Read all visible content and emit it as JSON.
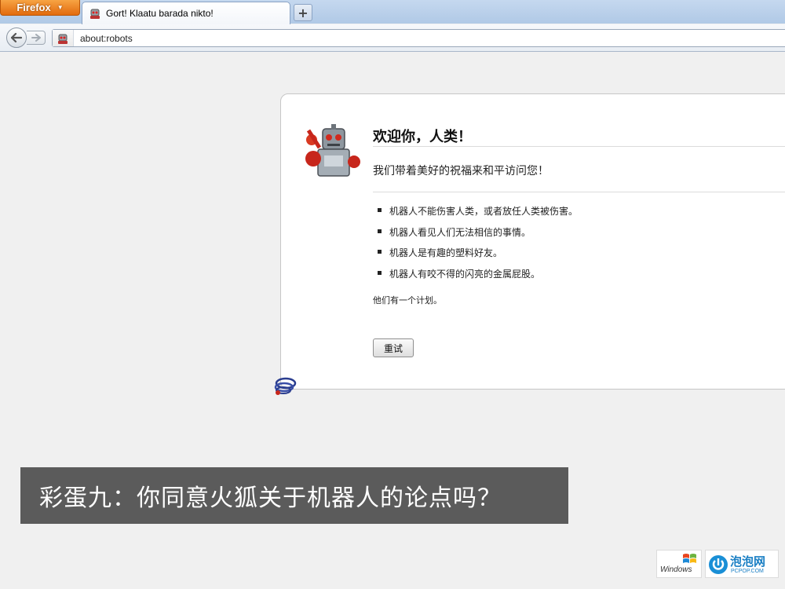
{
  "browser": {
    "app_menu_label": "Firefox",
    "tab_title": "Gort! Klaatu barada nikto!",
    "new_tab_label": "+",
    "url": "about:robots"
  },
  "page": {
    "title": "欢迎你，人类！",
    "subtitle": "我们带着美好的祝福来和平访问您！",
    "laws": [
      "机器人不能伤害人类，或者放任人类被伤害。",
      "机器人看见人们无法相信的事情。",
      "机器人是有趣的塑料好友。",
      "机器人有咬不得的闪亮的金属屁股。"
    ],
    "plan": "他们有一个计划。",
    "try_again_label": "重试"
  },
  "caption": {
    "text": "彩蛋九：你同意火狐关于机器人的论点吗？"
  },
  "watermarks": {
    "windows_text": "Windows",
    "pcpop_name": "泡泡网",
    "pcpop_domain": "PCPOP.COM"
  },
  "colors": {
    "firefox_button": "#e26b0e",
    "tabstrip": "#b0c9e6",
    "caption_band": "#5b5b5b",
    "pcpop_blue": "#1a7fc4"
  }
}
